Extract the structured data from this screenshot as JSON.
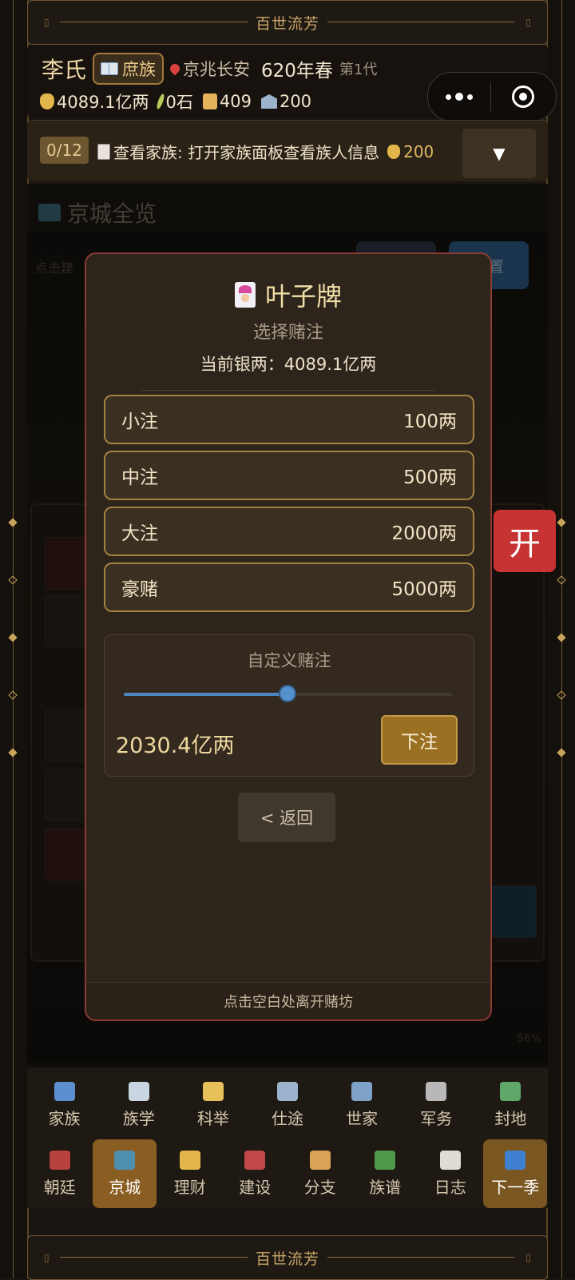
{
  "top_banner": {
    "title": "百世流芳"
  },
  "bottom_banner": {
    "title": "百世流芳"
  },
  "header": {
    "family_name": "李氏",
    "rank": "庶族",
    "location": "京兆长安",
    "season": "620年春",
    "generation": "第1代",
    "resources": {
      "silver": "4089.1亿两",
      "grain": "0石",
      "scrolls": "409",
      "influence": "200"
    }
  },
  "task": {
    "progress": "0/12",
    "text": "查看家族: 打开家族面板查看族人信息",
    "reward": "200",
    "toggle": "▼"
  },
  "map": {
    "title": "京城全览",
    "hint": "点击建",
    "reset": "重置",
    "zoom": "56%"
  },
  "open_button": "开",
  "modal": {
    "title": "叶子牌",
    "subtitle": "选择赌注",
    "current_silver": "当前银两：4089.1亿两",
    "bets": [
      {
        "label": "小注",
        "amount": "100两"
      },
      {
        "label": "中注",
        "amount": "500两"
      },
      {
        "label": "大注",
        "amount": "2000两"
      },
      {
        "label": "豪赌",
        "amount": "5000两"
      }
    ],
    "custom": {
      "label": "自定义赌注",
      "value": "2030.4亿两",
      "slider_fraction": 0.497,
      "place_bet": "下注"
    },
    "back": "< 返回",
    "footer": "点击空白处离开赌坊"
  },
  "nav": {
    "row1": [
      {
        "label": "家族",
        "icon": "family-icon",
        "color": "#5b8fcf"
      },
      {
        "label": "族学",
        "icon": "book-icon",
        "color": "#c9d5e0"
      },
      {
        "label": "科举",
        "icon": "memo-icon",
        "color": "#e8c05a"
      },
      {
        "label": "仕途",
        "icon": "government-icon",
        "color": "#9bb3cc"
      },
      {
        "label": "世家",
        "icon": "castle-icon",
        "color": "#7fa3c8"
      },
      {
        "label": "军务",
        "icon": "swords-icon",
        "color": "#b8b8b8"
      },
      {
        "label": "封地",
        "icon": "landscape-icon",
        "color": "#5fa86a"
      }
    ],
    "row2": [
      {
        "label": "朝廷",
        "icon": "palace-icon",
        "color": "#b8423e",
        "active": false
      },
      {
        "label": "京城",
        "icon": "map-icon",
        "color": "#4f8fb0",
        "active": true
      },
      {
        "label": "理财",
        "icon": "moneybag-icon",
        "color": "#e2b64a",
        "active": false
      },
      {
        "label": "建设",
        "icon": "crane-icon",
        "color": "#c04848",
        "active": false
      },
      {
        "label": "分支",
        "icon": "houses-icon",
        "color": "#d9a456",
        "active": false
      },
      {
        "label": "族谱",
        "icon": "tree-icon",
        "color": "#4e9a4a",
        "active": false
      },
      {
        "label": "日志",
        "icon": "clipboard-icon",
        "color": "#e0dcd4",
        "active": false
      },
      {
        "label": "下一季",
        "icon": "fast-forward-icon",
        "color": "#3f7fcf",
        "active": false
      }
    ]
  }
}
